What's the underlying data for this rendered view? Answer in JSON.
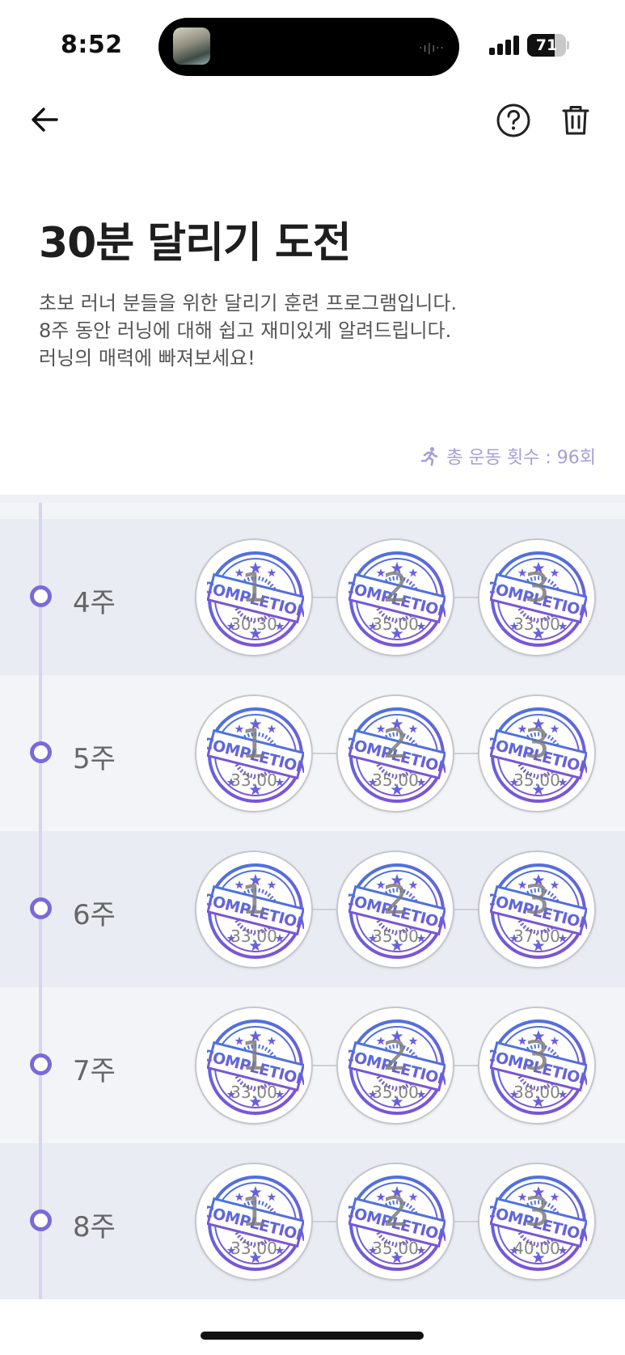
{
  "status_bar": {
    "time": "8:52",
    "battery": "71",
    "battery_level": 0.71
  },
  "header": {
    "back_icon": "arrow-left-icon",
    "help_icon": "question-circle-icon",
    "trash_icon": "trash-icon"
  },
  "program": {
    "title": "30분 달리기 도전",
    "description": [
      "초보 러너 분들을 위한 달리기 훈련 프로그램입니다.",
      "8주 동안 러닝에 대해 쉽고 재미있게 알려드립니다.",
      "러닝의 매력에 빠져보세요!"
    ],
    "total_count": "총 운동 횟수 : 96회"
  },
  "colors": {
    "accent": "#7a6ad8",
    "stamp_blue": "#4a74e0",
    "stamp_purple": "#7a55d8"
  },
  "stamp_text": "COMPLETION",
  "weeks": [
    {
      "label": "4주",
      "sessions": [
        {
          "num": "1",
          "time": "30:30"
        },
        {
          "num": "2",
          "time": "35:00"
        },
        {
          "num": "3",
          "time": "33:00"
        }
      ]
    },
    {
      "label": "5주",
      "sessions": [
        {
          "num": "1",
          "time": "33:00"
        },
        {
          "num": "2",
          "time": "35:00"
        },
        {
          "num": "3",
          "time": "35:00"
        }
      ]
    },
    {
      "label": "6주",
      "sessions": [
        {
          "num": "1",
          "time": "33:00"
        },
        {
          "num": "2",
          "time": "35:00"
        },
        {
          "num": "3",
          "time": "37:00"
        }
      ]
    },
    {
      "label": "7주",
      "sessions": [
        {
          "num": "1",
          "time": "33:00"
        },
        {
          "num": "2",
          "time": "35:00"
        },
        {
          "num": "3",
          "time": "38:00"
        }
      ]
    },
    {
      "label": "8주",
      "sessions": [
        {
          "num": "1",
          "time": "33:00"
        },
        {
          "num": "2",
          "time": "35:00"
        },
        {
          "num": "3",
          "time": "40:00"
        }
      ]
    }
  ]
}
